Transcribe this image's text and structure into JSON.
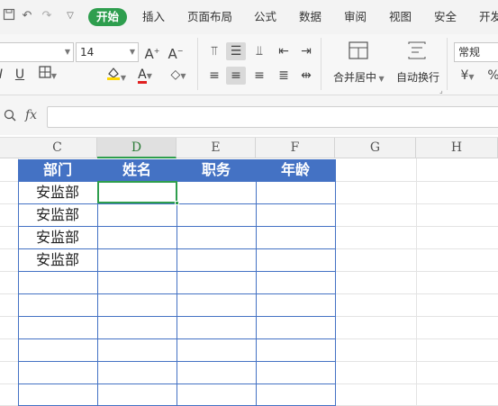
{
  "menubar": {
    "quick_access_icons": [
      "save-icon",
      "undo-icon",
      "redo-icon",
      "customize-icon"
    ],
    "tabs": [
      "开始",
      "插入",
      "页面布局",
      "公式",
      "数据",
      "审阅",
      "视图",
      "安全",
      "开发"
    ],
    "active_tab": "开始"
  },
  "ribbon": {
    "font_name": "",
    "font_size": "14",
    "merge_center_label": "合并居中",
    "wrap_text_label": "自动换行",
    "number_format": "常规",
    "accent_colors": {
      "font_color": "#e02020",
      "highlight": "#ffd700"
    }
  },
  "formula_bar": {
    "fx_label": "fx",
    "value": ""
  },
  "sheet": {
    "columns": [
      "C",
      "D",
      "E",
      "F",
      "G",
      "H"
    ],
    "selected_column": "D",
    "header_row": [
      "部门",
      "姓名",
      "职务",
      "年龄"
    ],
    "rows": [
      [
        "安监部",
        "",
        "",
        ""
      ],
      [
        "安监部",
        "",
        "",
        ""
      ],
      [
        "安监部",
        "",
        "",
        ""
      ],
      [
        "安监部",
        "",
        "",
        ""
      ]
    ],
    "header_fill": "#4472c4",
    "active_cell": "D2"
  }
}
